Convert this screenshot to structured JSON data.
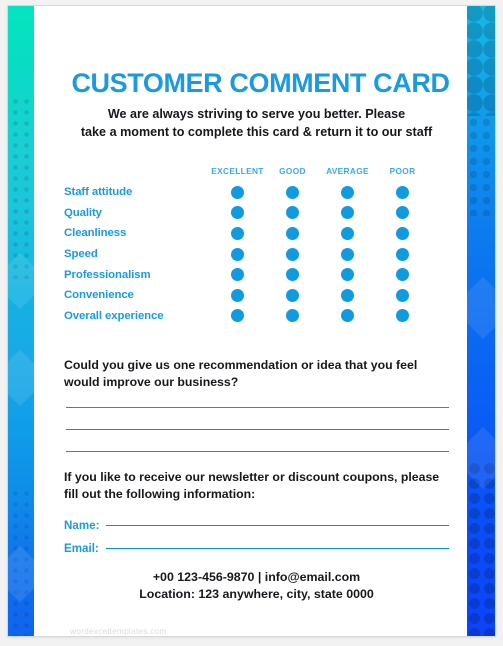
{
  "document": {
    "title": "CUSTOMER COMMENT CARD",
    "subtitle_line1": "We are always striving to serve you better. Please",
    "subtitle_line2": "take a moment to complete this card & return it to our staff"
  },
  "rating": {
    "columns": [
      "EXCELLENT",
      "GOOD",
      "AVERAGE",
      "POOR"
    ],
    "rows": [
      {
        "label": "Staff attitude"
      },
      {
        "label": "Quality"
      },
      {
        "label": "Cleanliness"
      },
      {
        "label": "Speed"
      },
      {
        "label": "Professionalism"
      },
      {
        "label": "Convenience"
      },
      {
        "label": "Overall experience"
      }
    ]
  },
  "question": {
    "text": "Could you give us one recommendation or idea that you feel would improve our business?",
    "answer_lines": 3
  },
  "newsletter": {
    "text": "If you like to receive our newsletter or discount coupons, please fill out the following information:",
    "fields": [
      {
        "label": "Name:",
        "value": ""
      },
      {
        "label": "Email:",
        "value": ""
      }
    ]
  },
  "contact": {
    "line1": "+00 123-456-9870 | info@email.com",
    "line2": "Location: 123 anywhere, city, state 0000"
  },
  "watermark": "wordexceltemplates.com",
  "colors": {
    "title_blue": "#1b9ae0",
    "label_blue": "#1b9ae0",
    "column_head_blue": "#3aa9e8",
    "dot_blue": "#109ae0",
    "rule_blue": "#0f93d8",
    "body_black": "#16181c",
    "strip_left_top": "#04e5bf",
    "strip_left_bottom": "#0f63f0",
    "strip_right_top": "#17b9e8",
    "strip_right_bottom": "#0c43f9"
  }
}
